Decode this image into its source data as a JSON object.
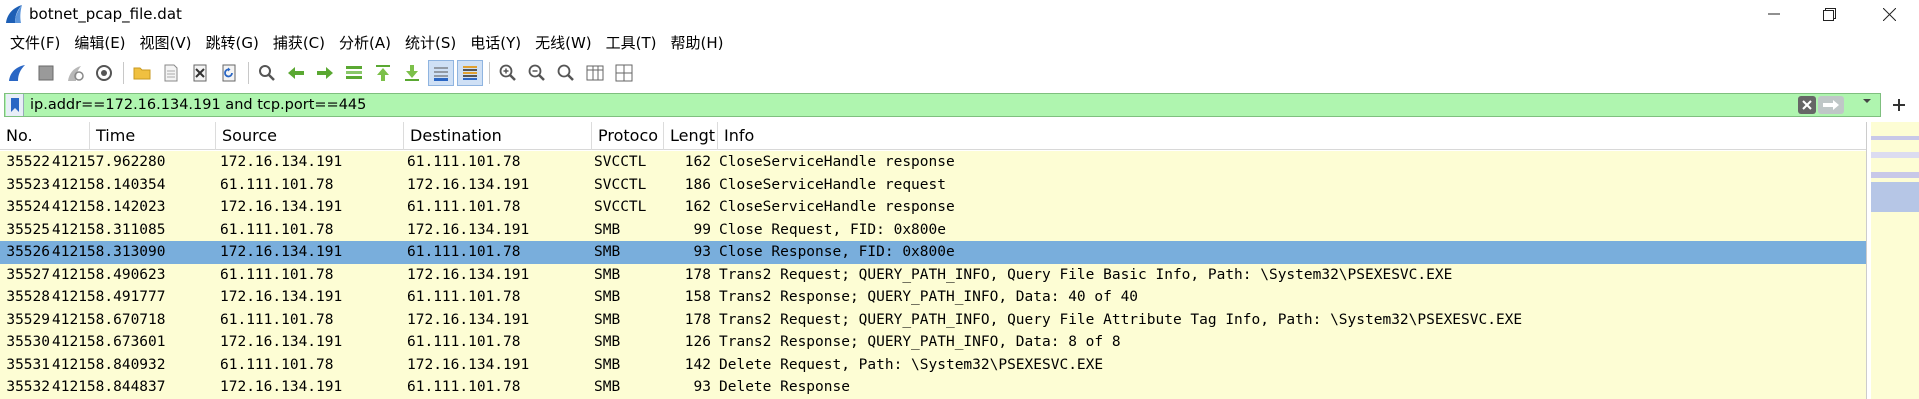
{
  "window": {
    "title": "botnet_pcap_file.dat",
    "minimize_icon": "minimize-icon",
    "maximize_icon": "restore-icon",
    "close_icon": "close-icon"
  },
  "menu": [
    "文件(F)",
    "编辑(E)",
    "视图(V)",
    "跳转(G)",
    "捕获(C)",
    "分析(A)",
    "统计(S)",
    "电话(Y)",
    "无线(W)",
    "工具(T)",
    "帮助(H)"
  ],
  "toolbar": {
    "icons": [
      "shark-fin-start-icon",
      "stop-icon",
      "restart-icon",
      "capture-options-icon",
      "open-folder-icon",
      "file-icon",
      "close-file-icon",
      "reload-icon",
      "find-icon",
      "go-back-icon",
      "go-forward-icon",
      "go-to-packet-icon",
      "go-first-icon",
      "go-last-icon",
      "autoscroll-icon",
      "colorize-icon",
      "zoom-in-icon",
      "zoom-out-icon",
      "zoom-normal-icon",
      "resize-columns-icon",
      "layout-icon"
    ]
  },
  "filter": {
    "value": "ip.addr==172.16.134.191 and tcp.port==445",
    "bookmark_icon": "bookmark-icon",
    "clear_icon": "clear-filter-icon",
    "apply_icon": "apply-arrow-icon",
    "dropdown_icon": "chevron-down-icon",
    "add_icon": "plus-icon"
  },
  "columns": [
    "No.",
    "Time",
    "Source",
    "Destination",
    "Protoco",
    "Lengt",
    "Info"
  ],
  "packets": [
    {
      "no": "35522",
      "time": "412157.962280",
      "src": "172.16.134.191",
      "dst": "61.111.101.78",
      "proto": "SVCCTL",
      "len": "162",
      "info": "CloseServiceHandle response"
    },
    {
      "no": "35523",
      "time": "412158.140354",
      "src": "61.111.101.78",
      "dst": "172.16.134.191",
      "proto": "SVCCTL",
      "len": "186",
      "info": "CloseServiceHandle request"
    },
    {
      "no": "35524",
      "time": "412158.142023",
      "src": "172.16.134.191",
      "dst": "61.111.101.78",
      "proto": "SVCCTL",
      "len": "162",
      "info": "CloseServiceHandle response"
    },
    {
      "no": "35525",
      "time": "412158.311085",
      "src": "61.111.101.78",
      "dst": "172.16.134.191",
      "proto": "SMB",
      "len": "99",
      "info": "Close Request, FID: 0x800e"
    },
    {
      "no": "35526",
      "time": "412158.313090",
      "src": "172.16.134.191",
      "dst": "61.111.101.78",
      "proto": "SMB",
      "len": "93",
      "info": "Close Response, FID: 0x800e",
      "selected": true
    },
    {
      "no": "35527",
      "time": "412158.490623",
      "src": "61.111.101.78",
      "dst": "172.16.134.191",
      "proto": "SMB",
      "len": "178",
      "info": "Trans2 Request; QUERY_PATH_INFO, Query File Basic Info, Path: \\System32\\PSEXESVC.EXE"
    },
    {
      "no": "35528",
      "time": "412158.491777",
      "src": "172.16.134.191",
      "dst": "61.111.101.78",
      "proto": "SMB",
      "len": "158",
      "info": "Trans2 Response; QUERY_PATH_INFO, Data: 40 of 40"
    },
    {
      "no": "35529",
      "time": "412158.670718",
      "src": "61.111.101.78",
      "dst": "172.16.134.191",
      "proto": "SMB",
      "len": "178",
      "info": "Trans2 Request; QUERY_PATH_INFO, Query File Attribute Tag Info, Path: \\System32\\PSEXESVC.EXE"
    },
    {
      "no": "35530",
      "time": "412158.673601",
      "src": "172.16.134.191",
      "dst": "61.111.101.78",
      "proto": "SMB",
      "len": "126",
      "info": "Trans2 Response; QUERY_PATH_INFO, Data: 8 of 8"
    },
    {
      "no": "35531",
      "time": "412158.840932",
      "src": "61.111.101.78",
      "dst": "172.16.134.191",
      "proto": "SMB",
      "len": "142",
      "info": "Delete Request, Path: \\System32\\PSEXESVC.EXE"
    },
    {
      "no": "35532",
      "time": "412158.844837",
      "src": "172.16.134.191",
      "dst": "61.111.101.78",
      "proto": "SMB",
      "len": "93",
      "info": "Delete Response"
    }
  ],
  "colors": {
    "row_bg": "#fdfdd4",
    "selected_bg": "#79aedc",
    "filter_valid_bg": "#aff5af"
  }
}
